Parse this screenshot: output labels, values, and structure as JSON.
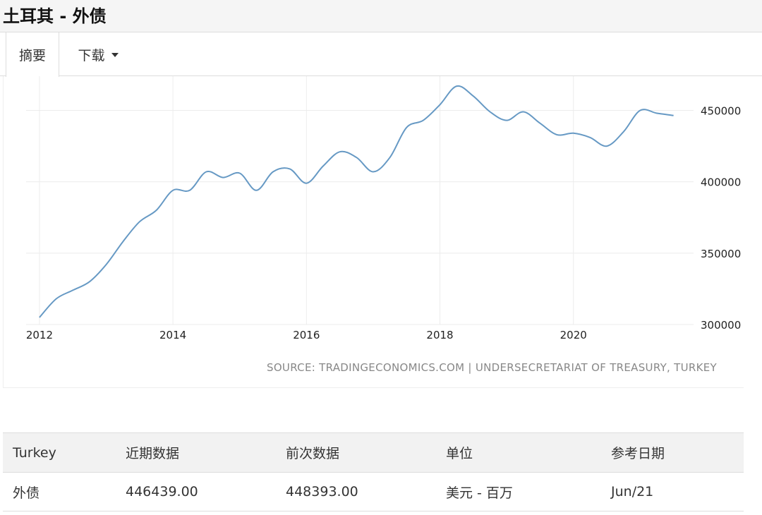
{
  "page": {
    "title": "土耳其 - 外债"
  },
  "tabs": [
    {
      "label": "摘要"
    },
    {
      "label": "下载"
    }
  ],
  "source": "SOURCE: TRADINGECONOMICS.COM | UNDERSECRETARIAT OF TREASURY, TURKEY",
  "colors": {
    "line": "#6699c4",
    "grid": "#ececec"
  },
  "chart_data": {
    "type": "line",
    "title": "",
    "xlabel": "",
    "ylabel": "",
    "ylim": [
      300000,
      470000
    ],
    "xlim": [
      2011.8,
      2021.8
    ],
    "x_ticks": [
      2012,
      2014,
      2016,
      2018,
      2020
    ],
    "x_tick_labels": [
      "2012",
      "2014",
      "2016",
      "2018",
      "2020"
    ],
    "y_ticks": [
      300000,
      350000,
      400000,
      450000
    ],
    "y_tick_labels": [
      "300000",
      "350000",
      "400000",
      "450000"
    ],
    "y_axis_position": "right",
    "grid": true,
    "legend": "none",
    "series": [
      {
        "x": [
          2012.0,
          2012.25,
          2012.5,
          2012.75,
          2013.0,
          2013.25,
          2013.5,
          2013.75,
          2014.0,
          2014.25,
          2014.5,
          2014.75,
          2015.0,
          2015.25,
          2015.5,
          2015.75,
          2016.0,
          2016.25,
          2016.5,
          2016.75,
          2017.0,
          2017.25,
          2017.5,
          2017.75,
          2018.0,
          2018.25,
          2018.5,
          2018.75,
          2019.0,
          2019.25,
          2019.5,
          2019.75,
          2020.0,
          2020.25,
          2020.5,
          2020.75,
          2021.0,
          2021.25,
          2021.5
        ],
        "y": [
          305000,
          318000,
          324000,
          330000,
          342000,
          358000,
          372000,
          380000,
          394000,
          394000,
          407000,
          403000,
          406000,
          394000,
          407000,
          409000,
          399000,
          411000,
          421000,
          417000,
          407000,
          417000,
          438000,
          443000,
          454000,
          467000,
          460000,
          449000,
          443000,
          449000,
          441000,
          433000,
          434000,
          431000,
          425000,
          435000,
          450000,
          448000,
          446439
        ]
      }
    ]
  },
  "table": {
    "headers": [
      "Turkey",
      "近期数据",
      "前次数据",
      "单位",
      "参考日期"
    ],
    "rows": [
      [
        "外债",
        "446439.00",
        "448393.00",
        "美元 - 百万",
        "Jun/21"
      ]
    ]
  }
}
